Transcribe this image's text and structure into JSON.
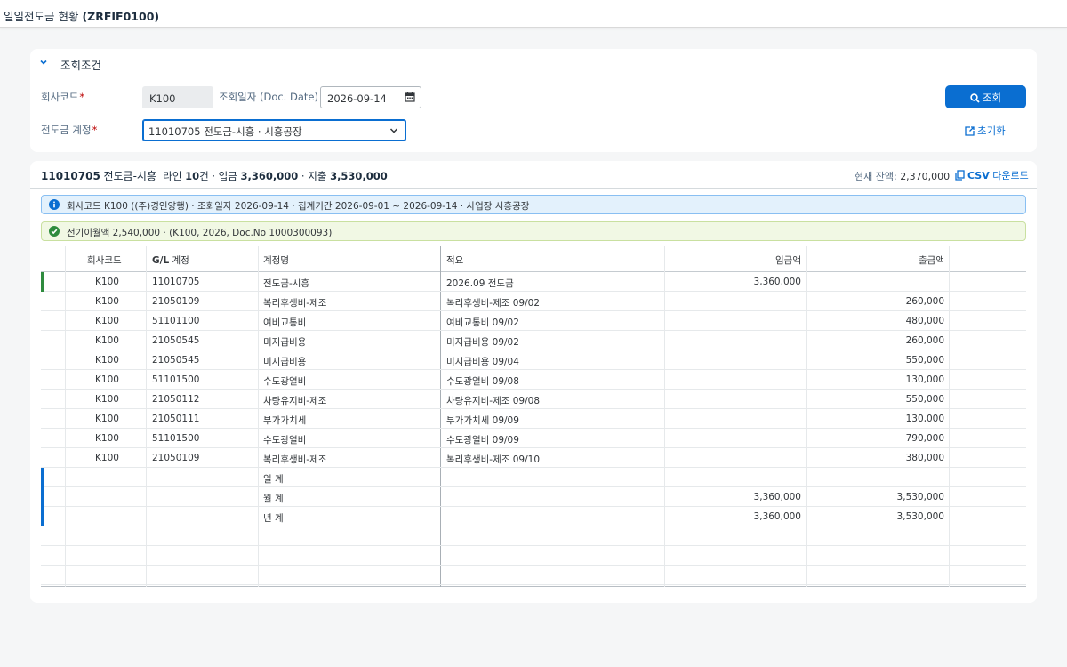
{
  "app": {
    "title": "일일전도금 현황",
    "code": "(ZRFIF0100)"
  },
  "filter": {
    "header": "조회조건",
    "company_label": "회사코드",
    "company_value": "K100",
    "date_label": "조회일자 (Doc. Date)",
    "date_value": "2026-09-14",
    "account_label": "전도금 계정",
    "account_value": "11010705 전도금-시흥 · 시흥공장",
    "search_label": "조회",
    "reset_label": "초기화",
    "required_mark": "*"
  },
  "result": {
    "account_code": "11010705",
    "account_name": "전도금-시흥",
    "summary_pre": "라인",
    "line_count": "10",
    "summary_mid": "건 · 입금",
    "in_total": "3,360,000",
    "summary_out": "· 지출",
    "out_total": "3,530,000",
    "balance_label": "현재 잔액:",
    "balance_value": "2,370,000",
    "csv_label": "CSV",
    "csv_suffix": "다운로드",
    "info_text": "회사코드 K100 ((주)경인양행) · 조회일자 2026-09-14 · 집계기간 2026-09-01 ~ 2026-09-14 · 사업장 시흥공장",
    "carry_text": "전기이월액 2,540,000 · (K100, 2026, Doc.No 1000300093)"
  },
  "table": {
    "headers": {
      "company": "회사코드",
      "gl_bold": "G/L",
      "gl_rest": "계정",
      "gl_name": "계정명",
      "desc": "적요",
      "in": "입금액",
      "out": "출금액"
    },
    "rows": [
      {
        "company": "K100",
        "gl": "11010705",
        "name": "전도금-시흥",
        "desc": "2026.09 전도금",
        "in": "3,360,000",
        "out": "",
        "marker": "#2e8b3e"
      },
      {
        "company": "K100",
        "gl": "21050109",
        "name": "복리후생비-제조",
        "desc": "복리후생비-제조 09/02",
        "in": "",
        "out": "260,000",
        "marker": ""
      },
      {
        "company": "K100",
        "gl": "51101100",
        "name": "여비교통비",
        "desc": "여비교통비 09/02",
        "in": "",
        "out": "480,000",
        "marker": ""
      },
      {
        "company": "K100",
        "gl": "21050545",
        "name": "미지급비용",
        "desc": "미지급비용 09/02",
        "in": "",
        "out": "260,000",
        "marker": ""
      },
      {
        "company": "K100",
        "gl": "21050545",
        "name": "미지급비용",
        "desc": "미지급비용 09/04",
        "in": "",
        "out": "550,000",
        "marker": ""
      },
      {
        "company": "K100",
        "gl": "51101500",
        "name": "수도광열비",
        "desc": "수도광열비 09/08",
        "in": "",
        "out": "130,000",
        "marker": ""
      },
      {
        "company": "K100",
        "gl": "21050112",
        "name": "차량유지비-제조",
        "desc": "차량유지비-제조 09/08",
        "in": "",
        "out": "550,000",
        "marker": ""
      },
      {
        "company": "K100",
        "gl": "21050111",
        "name": "부가가치세",
        "desc": "부가가치세 09/09",
        "in": "",
        "out": "130,000",
        "marker": ""
      },
      {
        "company": "K100",
        "gl": "51101500",
        "name": "수도광열비",
        "desc": "수도광열비 09/09",
        "in": "",
        "out": "790,000",
        "marker": ""
      },
      {
        "company": "K100",
        "gl": "21050109",
        "name": "복리후생비-제조",
        "desc": "복리후생비-제조 09/10",
        "in": "",
        "out": "380,000",
        "marker": ""
      },
      {
        "company": "",
        "gl": "",
        "name": "일 계",
        "desc": "",
        "in": "",
        "out": "",
        "marker": "#0a6ed1"
      },
      {
        "company": "",
        "gl": "",
        "name": "월 계",
        "desc": "",
        "in": "3,360,000",
        "out": "3,530,000",
        "marker": "#0a6ed1"
      },
      {
        "company": "",
        "gl": "",
        "name": "년 계",
        "desc": "",
        "in": "3,360,000",
        "out": "3,530,000",
        "marker": "#0a6ed1"
      },
      {
        "company": "",
        "gl": "",
        "name": "",
        "desc": "",
        "in": "",
        "out": "",
        "marker": ""
      },
      {
        "company": "",
        "gl": "",
        "name": "",
        "desc": "",
        "in": "",
        "out": "",
        "marker": ""
      },
      {
        "company": "",
        "gl": "",
        "name": "",
        "desc": "",
        "in": "",
        "out": "",
        "marker": ""
      }
    ]
  },
  "icons": {
    "collapse": "chevron-down-icon",
    "calendar": "calendar-icon",
    "dropdown": "dropdown-arrow-icon",
    "search": "search-icon",
    "reset": "reset-icon",
    "csv": "csv-download-icon",
    "info": "info-icon",
    "success": "success-icon"
  },
  "colors": {
    "accent": "#0a6ed1",
    "required": "#bb0000",
    "success": "#2e8b3e",
    "info_bg": "#e3f1fc",
    "success_bg": "#f1f8e4"
  }
}
